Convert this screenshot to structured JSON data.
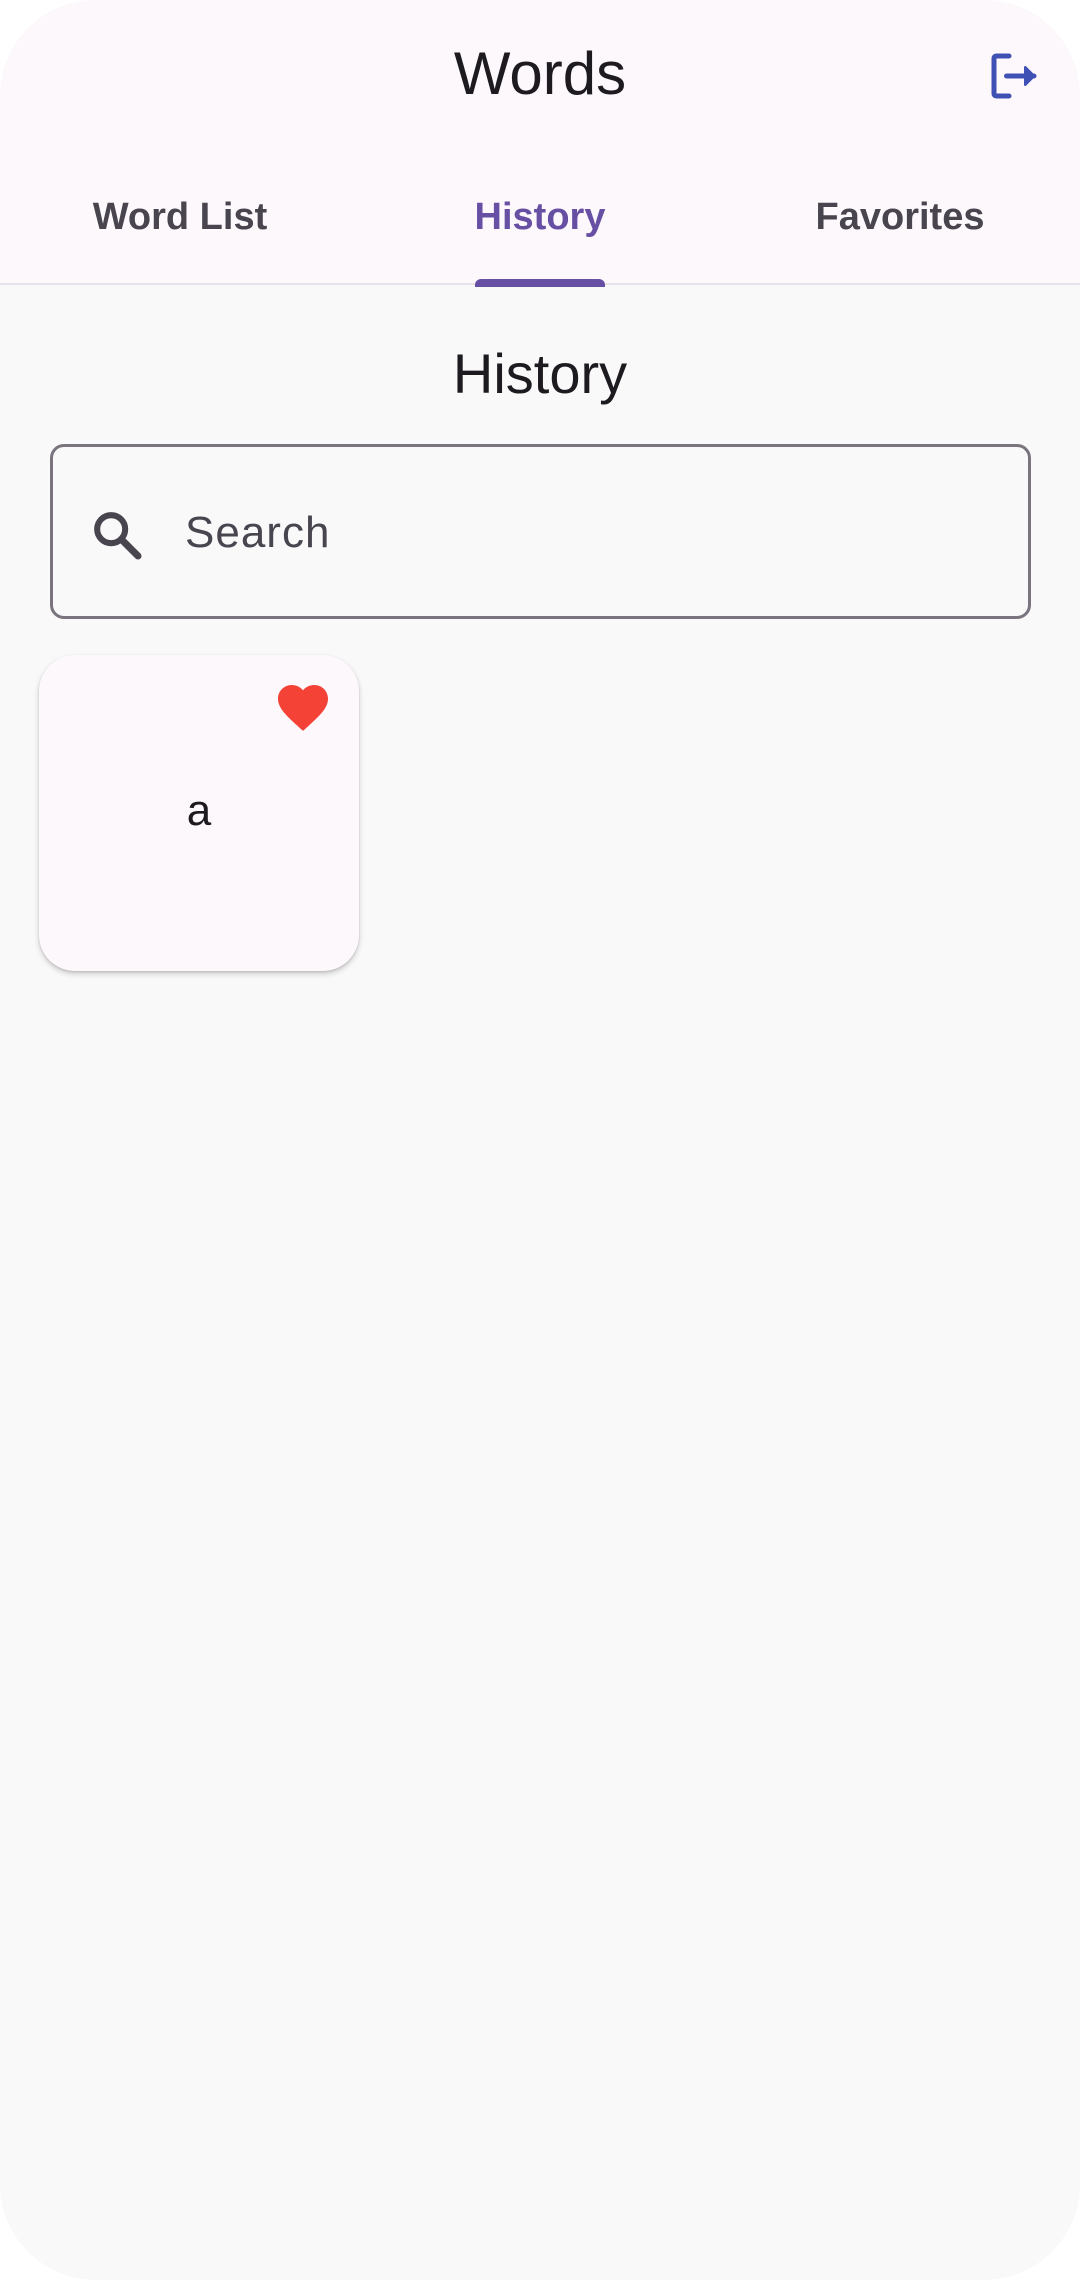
{
  "header": {
    "title": "Words",
    "logout_icon": "logout-icon",
    "accent_color": "#3f51b5"
  },
  "tabs": [
    {
      "label": "Word List",
      "active": false
    },
    {
      "label": "History",
      "active": true
    },
    {
      "label": "Favorites",
      "active": false
    }
  ],
  "main": {
    "title": "History",
    "search": {
      "placeholder": "Search",
      "value": "",
      "icon": "search-icon"
    },
    "words": [
      {
        "word": "a",
        "favorite": true,
        "favorite_icon": "heart-icon",
        "favorite_color": "#f44336"
      }
    ]
  },
  "colors": {
    "primary": "#6750a4",
    "background": "#f9f9f9",
    "surface": "#fdf8fc"
  }
}
